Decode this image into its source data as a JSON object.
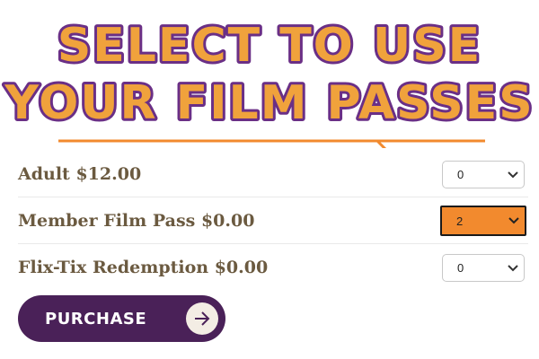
{
  "banner": {
    "line1": "SELECT TO USE",
    "line2": "YOUR FILM PASSES"
  },
  "tickets": [
    {
      "label": "Adult $12.00",
      "quantity": "0",
      "highlighted": false
    },
    {
      "label": "Member Film Pass $0.00",
      "quantity": "2",
      "highlighted": true
    },
    {
      "label": "Flix-Tix Redemption $0.00",
      "quantity": "0",
      "highlighted": false
    }
  ],
  "purchase": {
    "label": "PURCHASE"
  },
  "icons": {
    "arrow": "arrow-right-icon",
    "dropdown": "chevron-down-icon"
  },
  "colors": {
    "banner_fill": "#f0a23c",
    "banner_outline": "#6a2f86",
    "callout_line": "#f28a2e",
    "highlight_select": "#f28a2e",
    "label_text": "#6b5a40",
    "purchase_bg": "#4a2158"
  }
}
